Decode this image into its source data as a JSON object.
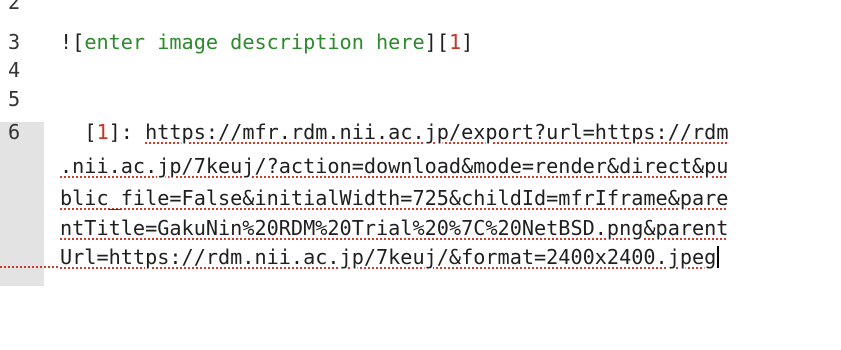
{
  "editor": {
    "line_numbers": [
      "2",
      "3",
      "4",
      "5",
      "6"
    ],
    "line3": {
      "prefix": "![",
      "alt_text": "enter image description here",
      "mid": "][",
      "ref": "1",
      "suffix": "]"
    },
    "line6": {
      "indent_open": "  [",
      "ref": "1",
      "close": "]: ",
      "wrapped": [
        "https://mfr.rdm.nii.ac.jp/export?url=https://rdm",
        ".nii.ac.jp/7keuj/?action=download&mode=render&direct&pu",
        "blic_file=False&initialWidth=725&childId=mfrIframe&pare",
        "ntTitle=GakuNin%20RDM%20Trial%20%7C%20NetBSD.png&parent",
        "Url=https://rdm.nii.ac.jp/7keuj/&format=2400x2400.jpeg"
      ]
    },
    "colors": {
      "alt_text": "#2e8a2e",
      "reference": "#c6362b",
      "spell_underline": "#d23b2a",
      "active_gutter": "#e3e3e3"
    }
  }
}
